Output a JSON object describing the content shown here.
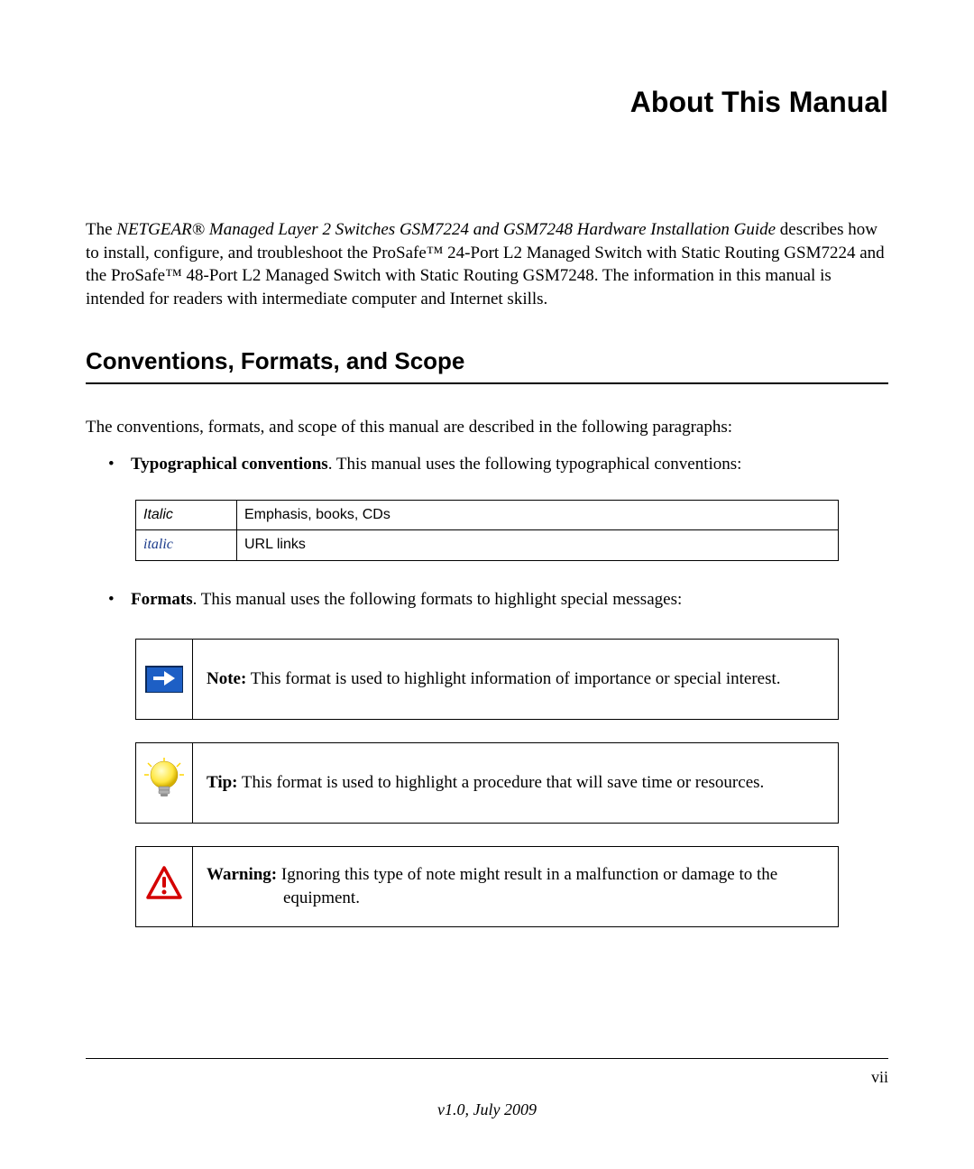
{
  "title": "About This Manual",
  "intro": {
    "lead": "The ",
    "doc_title": "NETGEAR® Managed Layer 2 Switches GSM7224 and GSM7248 Hardware Installation Guide",
    "rest": " describes how to install, configure, and troubleshoot the ProSafe™ 24-Port L2 Managed Switch with Static Routing GSM7224 and the ProSafe™ 48-Port L2 Managed Switch with Static Routing GSM7248. The information in this manual is intended for readers with intermediate computer and Internet skills."
  },
  "section_heading": "Conventions, Formats, and Scope",
  "section_intro": "The conventions, formats, and scope of this manual are described in the following paragraphs:",
  "bullets": {
    "typo_label": "Typographical conventions",
    "typo_rest": ". This manual uses the following typographical conventions:",
    "formats_label": "Formats",
    "formats_rest": ". This manual uses the following formats to highlight special messages:"
  },
  "conv_table": {
    "row1_col1": "Italic",
    "row1_col2": "Emphasis, books, CDs",
    "row2_col1": "italic",
    "row2_col2": "URL links"
  },
  "callouts": {
    "note_label": "Note:",
    "note_text": " This format is used to highlight information of importance or special interest.",
    "tip_label": "Tip:",
    "tip_text": " This format is used to highlight a procedure that will save time or resources.",
    "warn_label": "Warning:",
    "warn_text_line1": " Ignoring this type of note might result in a malfunction or damage to the",
    "warn_text_line2": "equipment."
  },
  "footer": {
    "pageno": "vii",
    "version": "v1.0, July 2009"
  }
}
